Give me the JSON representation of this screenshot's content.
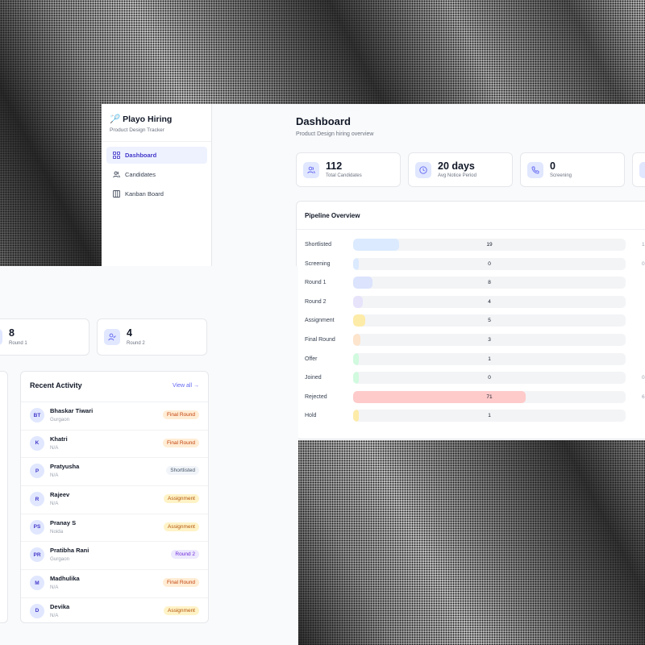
{
  "brand": {
    "emoji": "🏸",
    "title": "Playo Hiring",
    "subtitle": "Product Design Tracker"
  },
  "sidebar": {
    "items": [
      {
        "label": "Dashboard",
        "icon": "dashboard-icon",
        "active": true
      },
      {
        "label": "Candidates",
        "icon": "users-icon",
        "active": false
      },
      {
        "label": "Kanban Board",
        "icon": "kanban-icon",
        "active": false
      }
    ]
  },
  "dashboard": {
    "title": "Dashboard",
    "subtitle": "Product Design hiring overview",
    "stats": [
      {
        "value": "112",
        "label": "Total Candidates",
        "icon": "users-icon"
      },
      {
        "value": "20 days",
        "label": "Avg Notice Period",
        "icon": "clock-icon"
      },
      {
        "value": "0",
        "label": "Screening",
        "icon": "phone-icon"
      }
    ]
  },
  "pipeline": {
    "title": "Pipeline Overview",
    "stages": [
      {
        "label": "Shortlisted",
        "count": "19",
        "pct": "1",
        "fraction": 0.17,
        "color": "#dbeafe"
      },
      {
        "label": "Screening",
        "count": "0",
        "pct": "0",
        "fraction": 0.02,
        "color": "#dbeafe"
      },
      {
        "label": "Round 1",
        "count": "8",
        "pct": "",
        "fraction": 0.07,
        "color": "#dbe3fd"
      },
      {
        "label": "Round 2",
        "count": "4",
        "pct": "",
        "fraction": 0.035,
        "color": "#e6e3fb"
      },
      {
        "label": "Assignment",
        "count": "5",
        "pct": "",
        "fraction": 0.045,
        "color": "#fdeba8"
      },
      {
        "label": "Final Round",
        "count": "3",
        "pct": "",
        "fraction": 0.027,
        "color": "#fde4cc"
      },
      {
        "label": "Offer",
        "count": "1",
        "pct": "",
        "fraction": 0.02,
        "color": "#d1fadf"
      },
      {
        "label": "Joined",
        "count": "0",
        "pct": "0",
        "fraction": 0.02,
        "color": "#d1fadf"
      },
      {
        "label": "Rejected",
        "count": "71",
        "pct": "6",
        "fraction": 0.634,
        "color": "#fecaca"
      },
      {
        "label": "Hold",
        "count": "1",
        "pct": "",
        "fraction": 0.02,
        "color": "#fdeba8"
      }
    ]
  },
  "activity_stats": [
    {
      "value": "8",
      "label": "Round 1",
      "icon": "user-icon"
    },
    {
      "value": "4",
      "label": "Round 2",
      "icon": "user-check-icon"
    }
  ],
  "activity": {
    "title": "Recent Activity",
    "view_all": "View all →",
    "items": [
      {
        "initials": "BT",
        "name": "Bhaskar Tiwari",
        "location": "Gurgaon",
        "status": "Final Round",
        "badge": "final"
      },
      {
        "initials": "K",
        "name": "Khatri",
        "location": "N/A",
        "status": "Final Round",
        "badge": "final"
      },
      {
        "initials": "P",
        "name": "Pratyusha",
        "location": "N/A",
        "status": "Shortlisted",
        "badge": "short"
      },
      {
        "initials": "R",
        "name": "Rajeev",
        "location": "N/A",
        "status": "Assignment",
        "badge": "assign"
      },
      {
        "initials": "PS",
        "name": "Pranay S",
        "location": "Noida",
        "status": "Assignment",
        "badge": "assign"
      },
      {
        "initials": "PR",
        "name": "Pratibha Rani",
        "location": "Gurgaon",
        "status": "Round 2",
        "badge": "round2"
      },
      {
        "initials": "M",
        "name": "Madhulika",
        "location": "N/A",
        "status": "Final Round",
        "badge": "final"
      },
      {
        "initials": "D",
        "name": "Devika",
        "location": "N/A",
        "status": "Assignment",
        "badge": "assign"
      }
    ]
  }
}
